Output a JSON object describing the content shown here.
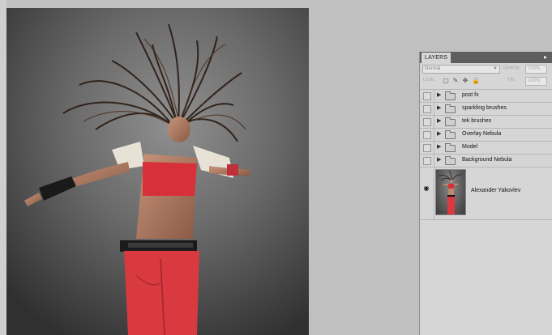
{
  "layers_panel": {
    "tab_label": "LAYERS",
    "blend_mode": "Normal",
    "opacity_label": "Opacity:",
    "opacity_value": "100%",
    "lock_label": "Lock:",
    "fill_label": "Fill:",
    "fill_value": "100%",
    "layers": [
      {
        "name": "post fx",
        "type": "group",
        "visible": false
      },
      {
        "name": "sparkling brushes",
        "type": "group",
        "visible": false
      },
      {
        "name": "tek brushes",
        "type": "group",
        "visible": false
      },
      {
        "name": "Overlay Nebula",
        "type": "group",
        "visible": false
      },
      {
        "name": "Model",
        "type": "group",
        "visible": false
      },
      {
        "name": "Background Nebula",
        "type": "group",
        "visible": false
      },
      {
        "name": "Alexander Yakovlev",
        "type": "image",
        "visible": true
      }
    ]
  },
  "icons": {
    "panel_menu": "panel-menu-icon",
    "lock_transparent": "lock-transparent-icon",
    "lock_image": "lock-image-icon",
    "lock_position": "lock-position-icon",
    "lock_all": "lock-all-icon",
    "folder": "folder-icon",
    "eye": "eye-icon"
  },
  "colors": {
    "canvas_bg": "#c0c0c0",
    "panel_bg": "#d6d6d6",
    "tabbar": "#5e5e5e",
    "top_red": "#d8303a",
    "pants_red": "#d83a40"
  }
}
